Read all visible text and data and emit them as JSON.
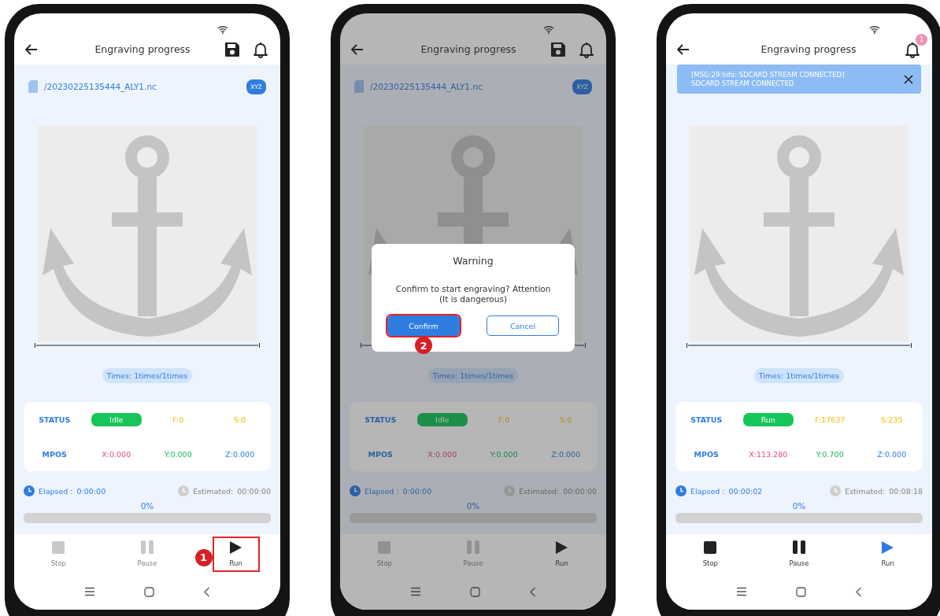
{
  "screens": [
    {
      "title": "Engraving progress",
      "header_icons": [
        {
          "kind": "save"
        },
        {
          "kind": "bell"
        }
      ],
      "file": {
        "name": "/20230225135444_ALY1.nc",
        "badge": "XYZ"
      },
      "times": "Times: 1times/1times",
      "status": {
        "label": "STATUS",
        "state": "Idle",
        "f": "F:0",
        "s": "S:0"
      },
      "mpos": {
        "label": "MPOS",
        "x": "X:0.000",
        "y": "Y:0.000",
        "z": "Z:0.000"
      },
      "elapsed": {
        "label": "Elapsed :",
        "value": "0:00:00"
      },
      "estimated": {
        "label": "Estimated:",
        "value": "00:00:00"
      },
      "progress": {
        "percent": "0%",
        "level": 0
      },
      "controls": [
        {
          "kind": "stop",
          "label": "Stop",
          "disabled": true,
          "active": false,
          "highlighted": false
        },
        {
          "kind": "pause",
          "label": "Pause",
          "disabled": true,
          "active": false,
          "highlighted": false
        },
        {
          "kind": "run",
          "label": "Run",
          "disabled": false,
          "active": false,
          "highlighted": true,
          "callout": "1"
        }
      ]
    },
    {
      "title": "Engraving progress",
      "header_icons": [
        {
          "kind": "save"
        },
        {
          "kind": "bell"
        }
      ],
      "file": {
        "name": "/20230225135444_ALY1.nc",
        "badge": "XYZ"
      },
      "times": "Times: 1times/1times",
      "status": {
        "label": "STATUS",
        "state": "Idle",
        "f": "F:0",
        "s": "S:0"
      },
      "mpos": {
        "label": "MPOS",
        "x": "X:0.000",
        "y": "Y:0.000",
        "z": "Z:0.000"
      },
      "elapsed": {
        "label": "Elapsed :",
        "value": "0:00:00"
      },
      "estimated": {
        "label": "Estimated:",
        "value": "00:00:00"
      },
      "progress": {
        "percent": "0%",
        "level": 0
      },
      "controls": [
        {
          "kind": "stop",
          "label": "Stop",
          "disabled": true,
          "active": false,
          "highlighted": false
        },
        {
          "kind": "pause",
          "label": "Pause",
          "disabled": true,
          "active": false,
          "highlighted": false
        },
        {
          "kind": "run",
          "label": "Run",
          "disabled": false,
          "active": false,
          "highlighted": false
        }
      ],
      "dialog": {
        "title": "Warning",
        "message": "Confirm to start engraving? Attention\n(It is dangerous)",
        "buttons": [
          {
            "kind": "primary",
            "label": "Confirm",
            "highlighted": true,
            "callout": "2"
          },
          {
            "kind": "outline",
            "label": "Cancel",
            "highlighted": false
          }
        ]
      }
    },
    {
      "title": "Engraving progress",
      "header_icons": [
        {
          "kind": "bell",
          "badge": "1"
        }
      ],
      "toast": {
        "lines": [
          "[MSG:29:Info: SDCARD STREAM CONNECTED]",
          "SDCARD STREAM CONNECTED"
        ]
      },
      "times": "Times: 1times/1times",
      "status": {
        "label": "STATUS",
        "state": "Run",
        "f": "F:17637",
        "s": "S:235"
      },
      "mpos": {
        "label": "MPOS",
        "x": "X:113.280",
        "y": "Y:0.700",
        "z": "Z:0.000"
      },
      "elapsed": {
        "label": "Elapsed :",
        "value": "00:00:02"
      },
      "estimated": {
        "label": "Estimated:",
        "value": "00:08:18"
      },
      "progress": {
        "percent": "0%",
        "level": 0
      },
      "controls": [
        {
          "kind": "stop",
          "label": "Stop",
          "disabled": false,
          "active": false,
          "highlighted": false
        },
        {
          "kind": "pause",
          "label": "Pause",
          "disabled": false,
          "active": false,
          "highlighted": false
        },
        {
          "kind": "run",
          "label": "Run",
          "disabled": false,
          "active": true,
          "highlighted": false
        }
      ]
    }
  ]
}
